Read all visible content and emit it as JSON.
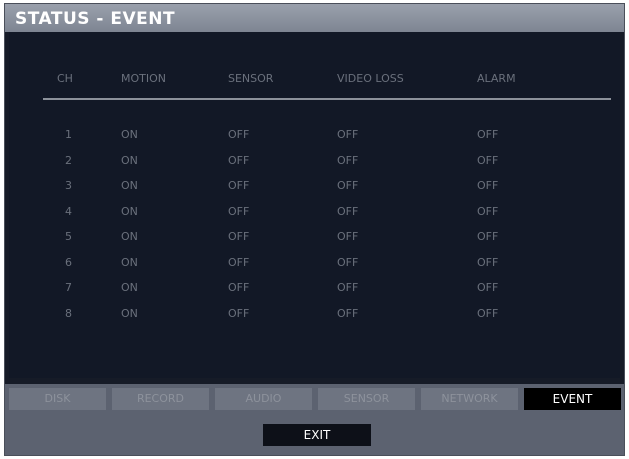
{
  "window": {
    "title": "STATUS - EVENT"
  },
  "table": {
    "headers": {
      "ch": "CH",
      "motion": "MOTION",
      "sensor": "SENSOR",
      "video_loss": "VIDEO LOSS",
      "alarm": "ALARM"
    },
    "rows": [
      {
        "ch": "1",
        "motion": "ON",
        "sensor": "OFF",
        "video_loss": "OFF",
        "alarm": "OFF"
      },
      {
        "ch": "2",
        "motion": "ON",
        "sensor": "OFF",
        "video_loss": "OFF",
        "alarm": "OFF"
      },
      {
        "ch": "3",
        "motion": "ON",
        "sensor": "OFF",
        "video_loss": "OFF",
        "alarm": "OFF"
      },
      {
        "ch": "4",
        "motion": "ON",
        "sensor": "OFF",
        "video_loss": "OFF",
        "alarm": "OFF"
      },
      {
        "ch": "5",
        "motion": "ON",
        "sensor": "OFF",
        "video_loss": "OFF",
        "alarm": "OFF"
      },
      {
        "ch": "6",
        "motion": "ON",
        "sensor": "OFF",
        "video_loss": "OFF",
        "alarm": "OFF"
      },
      {
        "ch": "7",
        "motion": "ON",
        "sensor": "OFF",
        "video_loss": "OFF",
        "alarm": "OFF"
      },
      {
        "ch": "8",
        "motion": "ON",
        "sensor": "OFF",
        "video_loss": "OFF",
        "alarm": "OFF"
      }
    ]
  },
  "tabs": [
    {
      "label": "DISK"
    },
    {
      "label": "RECORD"
    },
    {
      "label": "AUDIO"
    },
    {
      "label": "SENSOR"
    },
    {
      "label": "NETWORK"
    },
    {
      "label": "EVENT",
      "active": true
    }
  ],
  "footer": {
    "exit_label": "EXIT"
  },
  "colors": {
    "panel_bg": "#121826",
    "titlebar": "#8a909c",
    "active_tab_bg": "#000000",
    "inactive_tab_bg": "#6e7481"
  }
}
